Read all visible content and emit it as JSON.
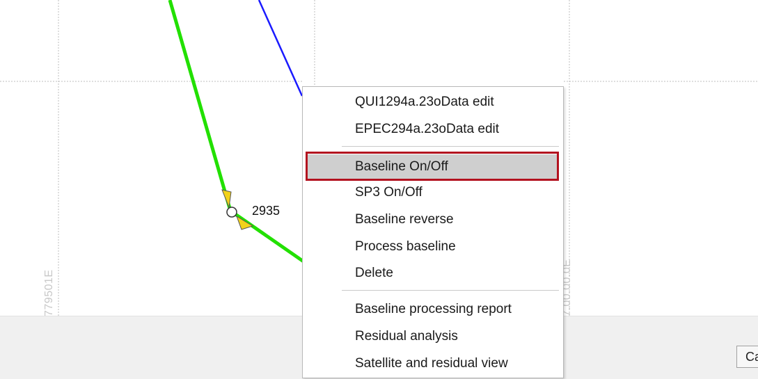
{
  "map": {
    "point_label": "2935",
    "axis_left_label": "779501E",
    "axis_mid_label": "7.00.00.0E",
    "colors": {
      "baseline_green": "#22e000",
      "baseline_blue": "#1a1aff",
      "grid": "#bdbdbd",
      "arrow_yellow": "#f2d21a"
    }
  },
  "context_menu": {
    "items": [
      {
        "label": "QUI1294a.23oData edit"
      },
      {
        "label": "EPEC294a.23oData edit"
      },
      {
        "label": "Baseline On/Off",
        "highlighted": true
      },
      {
        "label": "SP3 On/Off"
      },
      {
        "label": "Baseline reverse"
      },
      {
        "label": "Process baseline"
      },
      {
        "label": "Delete"
      },
      {
        "label": "Baseline processing report"
      },
      {
        "label": "Residual analysis"
      },
      {
        "label": "Satellite and residual view"
      }
    ]
  },
  "bottom_bar": {
    "button_label": "Ca"
  },
  "annotation": {
    "highlight_color": "#b3121f"
  }
}
